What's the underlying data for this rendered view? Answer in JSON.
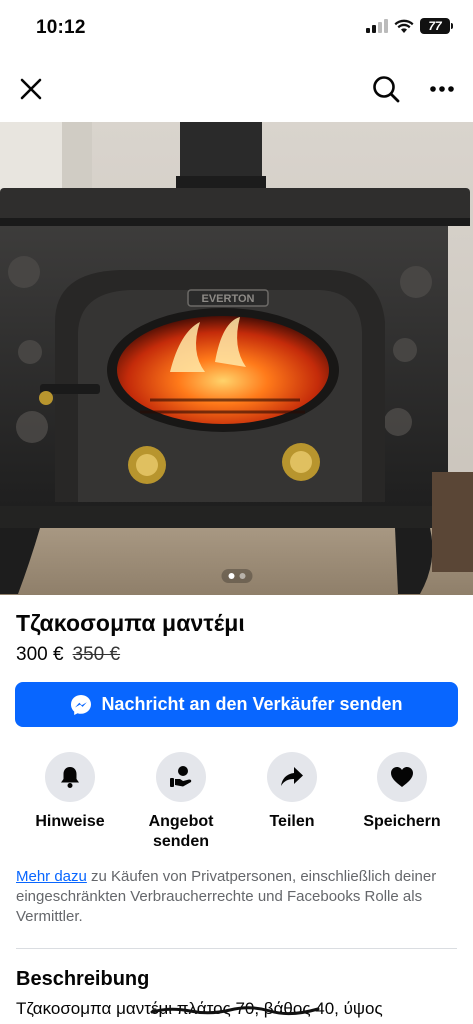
{
  "status": {
    "time": "10:12",
    "battery": "77"
  },
  "listing": {
    "title": "Τζακοσομπα μαντέμι",
    "price": "300 €",
    "old_price": "350 €",
    "image_brand_plate": "EVERTON",
    "image_count": 2,
    "image_index": 1
  },
  "message_button": {
    "label": "Nachricht an den Verkäufer senden"
  },
  "actions": [
    {
      "label": "Hinweise",
      "icon": "bell-icon"
    },
    {
      "label": "Angebot senden",
      "icon": "offer-hand-icon"
    },
    {
      "label": "Teilen",
      "icon": "share-arrow-icon"
    },
    {
      "label": "Speichern",
      "icon": "heart-icon"
    }
  ],
  "legal": {
    "link": "Mehr dazu",
    "text": " zu Käufen von Privatpersonen, einschließlich deiner eingeschränkten Verbraucherrechte und Facebooks Rolle als Vermittler."
  },
  "description": {
    "heading": "Beschreibung",
    "text": "Τζακοσομπα μαντέμι πλάτος 70, βάθος 40, ύψος"
  },
  "colors": {
    "accent": "#0866ff",
    "button_circle": "#e4e6eb",
    "secondary_text": "#65676b"
  }
}
